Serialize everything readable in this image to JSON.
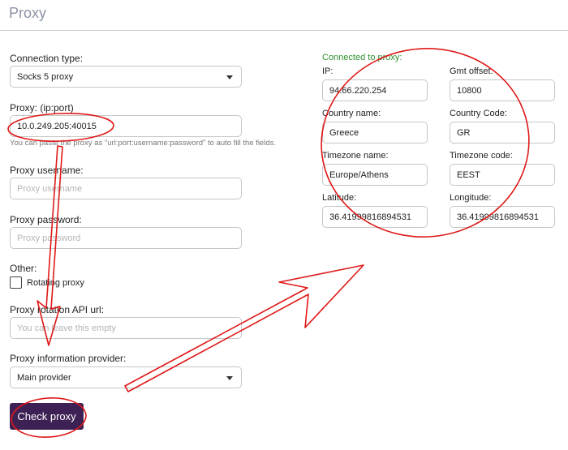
{
  "header": {
    "title": "Proxy"
  },
  "form": {
    "connection_type": {
      "label": "Connection type:",
      "value": "Socks 5 proxy"
    },
    "proxy": {
      "label": "Proxy: (ip:port)",
      "value": "10.0.249.205:40015",
      "hint": "You can paste the proxy as \"url:port:username:password\" to auto fill the fields."
    },
    "username": {
      "label": "Proxy username:",
      "placeholder": "Proxy username"
    },
    "password": {
      "label": "Proxy password:",
      "placeholder": "Proxy password"
    },
    "other": {
      "label": "Other:",
      "rotating_label": "Rotating proxy",
      "rotating_checked": false
    },
    "rotation_url": {
      "label": "Proxy rotation API url:",
      "placeholder": "You can leave this empty"
    },
    "info_provider": {
      "label": "Proxy information provider:",
      "value": "Main provider"
    },
    "check_button": "Check proxy"
  },
  "result": {
    "status": "Connected to proxy:",
    "ip": {
      "label": "IP:",
      "value": "94.66.220.254"
    },
    "gmt_offset": {
      "label": "Gmt offset:",
      "value": "10800"
    },
    "country_name": {
      "label": "Country name:",
      "value": "Greece"
    },
    "country_code": {
      "label": "Country Code:",
      "value": "GR"
    },
    "timezone_name": {
      "label": "Timezone name:",
      "value": "Europe/Athens"
    },
    "timezone_code": {
      "label": "Timezone code:",
      "value": "EEST"
    },
    "latitude": {
      "label": "Latitude:",
      "value": "36.41999816894531"
    },
    "longitude": {
      "label": "Longitude:",
      "value": "36.41999816894531"
    }
  },
  "colors": {
    "accent": "#3d2155",
    "status_green": "#2f8f2f",
    "annotation_red": "#e01818"
  },
  "icons": {
    "select_caret": "chevron-down-icon"
  }
}
